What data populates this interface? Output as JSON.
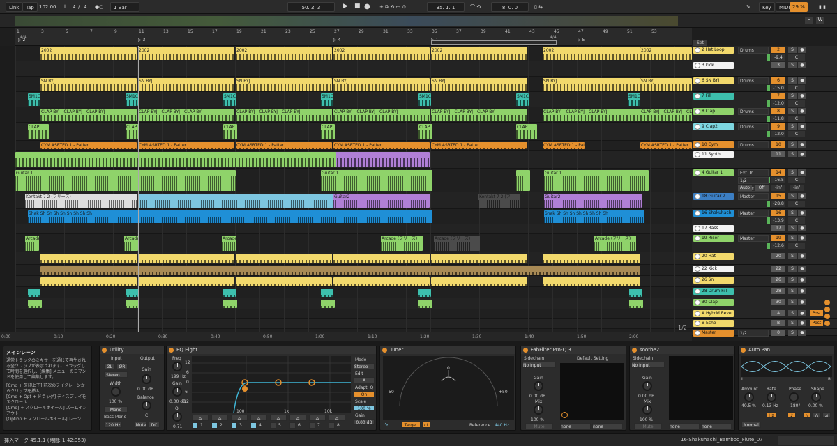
{
  "topbar": {
    "link": "Link",
    "tap": "Tap",
    "tempo": "102.00",
    "meter_num": "4",
    "meter_sep": "/",
    "meter_den": "4",
    "quantize": "1 Bar",
    "position": "50.  2.  3",
    "loop_start": "35.  1.  1",
    "loop_len": "8.  0.  0",
    "key": "Key",
    "midi": "MIDI",
    "cpu": "29 %"
  },
  "ruler": {
    "bars": [
      "1",
      "3",
      "5",
      "7",
      "9",
      "11",
      "13",
      "15",
      "17",
      "19",
      "21",
      "23",
      "25",
      "27",
      "29",
      "31",
      "33",
      "35",
      "37",
      "39",
      "41",
      "43",
      "45",
      "47",
      "49",
      "51",
      "53"
    ],
    "markers": [
      "2",
      "3",
      "4",
      "1",
      "5"
    ],
    "sig1": "4/4",
    "sig2": "4/4"
  },
  "timeline": [
    "0:00",
    "0:10",
    "0:20",
    "0:30",
    "0:40",
    "0:50",
    "1:00",
    "1:10",
    "1:20",
    "1:30",
    "1:40",
    "1:50",
    "2:00"
  ],
  "clip_labels": {
    "hat": "2002",
    "snare": "SN BYJ",
    "sm": "SM1C",
    "clap": "CLAP BYJ - CLAP BYJ - CLAP BYJ",
    "clap_short": "CLAP",
    "cym": "CYM ASRTED 1 - Patter",
    "guitar1": "Guitar 1",
    "kontakt": "Kontakt 7 2 (フリーズ)",
    "kon": "Kon",
    "guitar2": "Guitar2",
    "shaku": "Shak Sh Sh Sh Sh Sh Sh Sh Sh",
    "arcade": "Arcade",
    "arcade_freeze": "Arcade (フリーズ)",
    "frozen": "クリップは無効です",
    "kontakt2": "Kontakt 7 2 (フ"
  },
  "mixer": {
    "set_label": "Set",
    "tracks": [
      {
        "name": "2 Hat Loop",
        "color": "#f2d96c",
        "input": "Drums",
        "num": "2",
        "vol": "-9.4",
        "pan": "C"
      },
      {
        "name": "3 kick",
        "color": "#f2f2f2",
        "num": "3"
      },
      {
        "name": "6 SN BYJ",
        "color": "#f2d96c",
        "input": "Drums",
        "num": "6",
        "vol": "-15.0",
        "pan": "C"
      },
      {
        "name": "7 Fill",
        "color": "#3dbfad",
        "num": "7",
        "vol": "-12.0",
        "pan": "C"
      },
      {
        "name": "8 Clap",
        "color": "#8fd36a",
        "input": "Drums",
        "num": "8",
        "vol": "-11.8",
        "pan": "C"
      },
      {
        "name": "9 Clap2",
        "color": "#7dd6e0",
        "input": "Drums",
        "num": "9",
        "vol": "-12.0",
        "pan": "C"
      },
      {
        "name": "10 Cym",
        "color": "#e5902d",
        "input": "Drums",
        "num": "10",
        "vol": "-18.2",
        "pan": "25L"
      },
      {
        "name": "11 Synth",
        "color": "#f2f2f2",
        "num": "11"
      },
      {
        "name": "4 Guitar 1",
        "color": "#8fd36a",
        "input": "Ext. In",
        "sub": "1/2",
        "out": "Master",
        "num": "14",
        "vol": "-16.5",
        "pan": "C",
        "auto": "Auto",
        "off": "Off",
        "inf1": "-inf",
        "inf2": "-inf"
      },
      {
        "name": "18 Guitar 2",
        "color": "#3c7fc4",
        "input": "Master",
        "num": "15",
        "vol": "-28.8",
        "pan": "C"
      },
      {
        "name": "16 Shakuhachi",
        "color": "#1f8fd6",
        "input": "Master",
        "num": "16",
        "vol": "-13.9",
        "pan": "C"
      },
      {
        "name": "17 Bass",
        "color": "#f2f2f2",
        "num": "17"
      },
      {
        "name": "19 Riser",
        "color": "#8fd36a",
        "input": "Master",
        "num": "19",
        "vol": "-12.6",
        "pan": "C"
      },
      {
        "name": "20 Hat",
        "color": "#f2d96c",
        "num": "20"
      },
      {
        "name": "22 Kick",
        "color": "#f2f2f2",
        "num": "22"
      },
      {
        "name": "26 Sn",
        "color": "#f2d96c",
        "num": "26"
      },
      {
        "name": "28 Drum Fill",
        "color": "#3dbfad",
        "num": "28"
      },
      {
        "name": "30 Clap",
        "color": "#8fd36a",
        "num": "30"
      },
      {
        "name": "A Hybrid Rever",
        "color": "#f2d96c",
        "num": "A",
        "post": "Post"
      },
      {
        "name": "B Echo",
        "color": "#f2d96c",
        "num": "B",
        "post": "Post"
      },
      {
        "name": "Master",
        "color": "#e5902d",
        "sub": "1/2",
        "num": "0"
      }
    ]
  },
  "info": {
    "title": "メインレーン",
    "text1": "通常トラックのミキサーを通じて再生される全クリップが表示されます。ドラッグして時間を選択し、[編集] メニューのコマンドを使用して編集します。",
    "text2": "[Cmd + 矢印上下] 前次のテイクレーンからクリップを挿入",
    "text3": "[Cmd + Opt + ドラッグ] ディスプレイをスクロール",
    "text4": "[Cmd] + スクロールホイール] ズームインアウト",
    "text5": "[Option + スクロールホイール] レーン"
  },
  "devices": {
    "utility": {
      "title": "Utility",
      "input": "Input",
      "output": "Output",
      "ch_l": "ØL",
      "ch_r": "ØR",
      "mode": "Stereo",
      "width": "Width",
      "width_val": "100 %",
      "mono": "Mono",
      "bass_mono": "Bass Mono",
      "bass_freq": "120 Hz",
      "gain": "Gain",
      "gain_val": "0.00 dB",
      "balance": "Balance",
      "balance_val": "C",
      "mute": "Mute",
      "dc": "DC"
    },
    "eq": {
      "title": "EQ Eight",
      "freq": "Freq",
      "freq_val": "199 Hz",
      "gain": "Gain",
      "gain_val": "0.00 dB",
      "q": "Q",
      "q_val": "0.71",
      "db": [
        "12",
        "6",
        "0",
        "-6",
        "-12"
      ],
      "hz": [
        "100",
        "1k",
        "10k"
      ],
      "mode": "Mode",
      "mode_val": "Stereo",
      "edit": "Edit",
      "edit_a": "A",
      "adapt": "Adapt. Q",
      "adapt_val": "On",
      "scale": "Scale",
      "scale_val": "100 %",
      "out_gain": "Gain",
      "out_gain_val": "0.00 dB",
      "bands": [
        "1",
        "2",
        "3",
        "4",
        "5",
        "6",
        "7",
        "8"
      ]
    },
    "tuner": {
      "title": "Tuner",
      "zero": "0",
      "minus": "-50",
      "plus": "+50",
      "target": "Target",
      "ct": "ct",
      "reference": "Reference",
      "ref_val": "440 Hz"
    },
    "proq": {
      "title": "FabFilter Pro-Q 3",
      "sidechain": "Sidechain",
      "no_input": "No Input",
      "preset": "Default Setting",
      "gain": "Gain",
      "gain_val": "0.00 dB",
      "mix": "Mix",
      "mix_val": "100 %",
      "mute": "Mute",
      "none1": "none",
      "none2": "none"
    },
    "soothe": {
      "title": "soothe2",
      "sidechain": "Sidechain",
      "no_input": "No Input",
      "gain": "Gain",
      "gain_val": "0.00 dB",
      "mix": "Mix",
      "mix_val": "100 %",
      "mute": "Mute",
      "none1": "none",
      "none2": "none"
    },
    "autopan": {
      "title": "Auto Pan",
      "amount": "Amount",
      "amount_val": "40.5 %",
      "rate": "Rate",
      "rate_val": "0.13 Hz",
      "phase": "Phase",
      "phase_val": "180°",
      "shape": "Shape",
      "shape_val": "0.00 %",
      "normal": "Normal",
      "hz": "Hz",
      "l": "L",
      "r": "R"
    }
  },
  "status": {
    "left": "挿入マーク 45.1.1 (時間: 1:42:353)",
    "right": "16-Shakuhachi_Bamboo_Flute_07"
  },
  "page_count": "1/2"
}
